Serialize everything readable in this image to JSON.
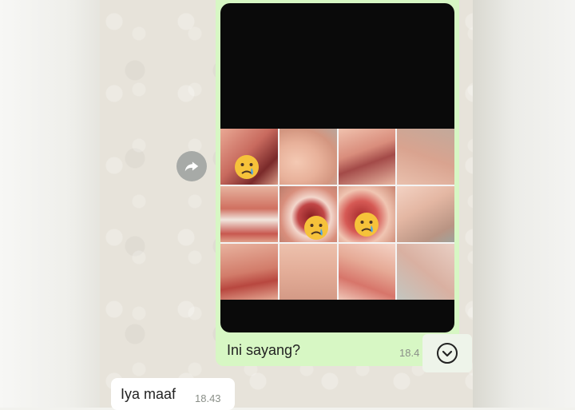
{
  "messages": [
    {
      "direction": "outgoing",
      "type": "image-with-caption",
      "caption": "Ini sayang?",
      "time": "18.4"
    },
    {
      "direction": "incoming",
      "type": "text",
      "text": "Iya maaf",
      "time": "18.43"
    }
  ],
  "icons": {
    "forward": "forward-arrow-icon",
    "scroll_down": "chevron-down-icon",
    "emoji": "crying-face-emoji"
  },
  "colors": {
    "outgoing_bubble": "#d7f7c4",
    "incoming_bubble": "#ffffff",
    "chat_background": "#e7e3da",
    "timestamp": "#8a8f88"
  }
}
